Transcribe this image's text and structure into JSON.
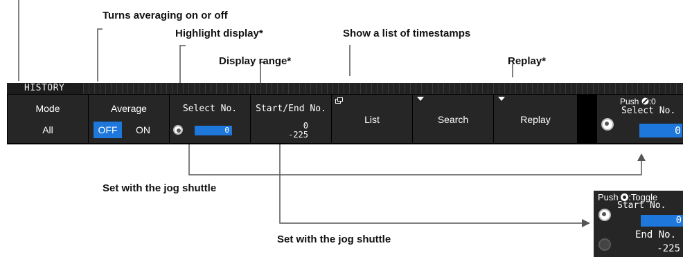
{
  "callouts": {
    "averaging": "Turns averaging on or off",
    "highlight": "Highlight display*",
    "timestamps": "Show a list of timestamps",
    "display_range": "Display range*",
    "replay": "Replay*",
    "jog1": "Set with the jog shuttle",
    "jog2": "Set with the jog shuttle"
  },
  "menu": {
    "tab_label": "HISTORY",
    "mode": {
      "label": "Mode",
      "value": "All"
    },
    "average": {
      "label": "Average",
      "off": "OFF",
      "on": "ON",
      "selected": "OFF"
    },
    "select_no": {
      "label": "Select No.",
      "value": "0"
    },
    "start_end": {
      "label": "Start/End No.",
      "start": "0",
      "end": "-225"
    },
    "list": {
      "label": "List"
    },
    "search": {
      "label": "Search"
    },
    "replay": {
      "label": "Replay"
    },
    "select_panel": {
      "push_text": ":0",
      "push_prefix": "Push",
      "label": "Select No.",
      "value": "0"
    }
  },
  "toggle_panel": {
    "push_prefix": "Push",
    "push_text": ":Toggle",
    "start_label": "Start No.",
    "start_value": "0",
    "end_label": "End No.",
    "end_value": "-225"
  },
  "colors": {
    "accent": "#1e78dc",
    "softkey_bg": "#262626",
    "bar_bg": "#000000"
  }
}
